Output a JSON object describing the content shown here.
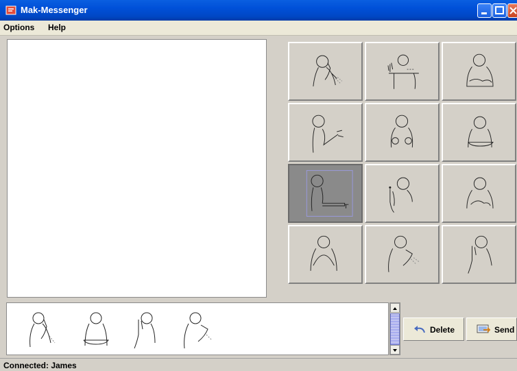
{
  "window": {
    "title": "Mak-Messenger",
    "colors": {
      "titlebar": "#0050d8",
      "face": "#d4d0c8",
      "selected_cell": "#8a8a8a"
    }
  },
  "menu": {
    "items": [
      "Options",
      "Help"
    ]
  },
  "sign_grid": {
    "selected_index": 6,
    "cells": [
      "sign-phone",
      "sign-arm-point",
      "sign-hands-together",
      "sign-reach",
      "sign-both-fists",
      "sign-hands-flat",
      "sign-point-right",
      "sign-finger-up",
      "sign-hands-clasp",
      "sign-hands-cup",
      "sign-hand-shoulder",
      "sign-thumb-up"
    ]
  },
  "compose": {
    "symbols": [
      "sign-phone",
      "sign-hands-flat",
      "sign-thumb-up",
      "sign-hand-shoulder"
    ]
  },
  "buttons": {
    "delete_label": "Delete",
    "send_label": "Send"
  },
  "status": {
    "text": "Connected: James"
  }
}
